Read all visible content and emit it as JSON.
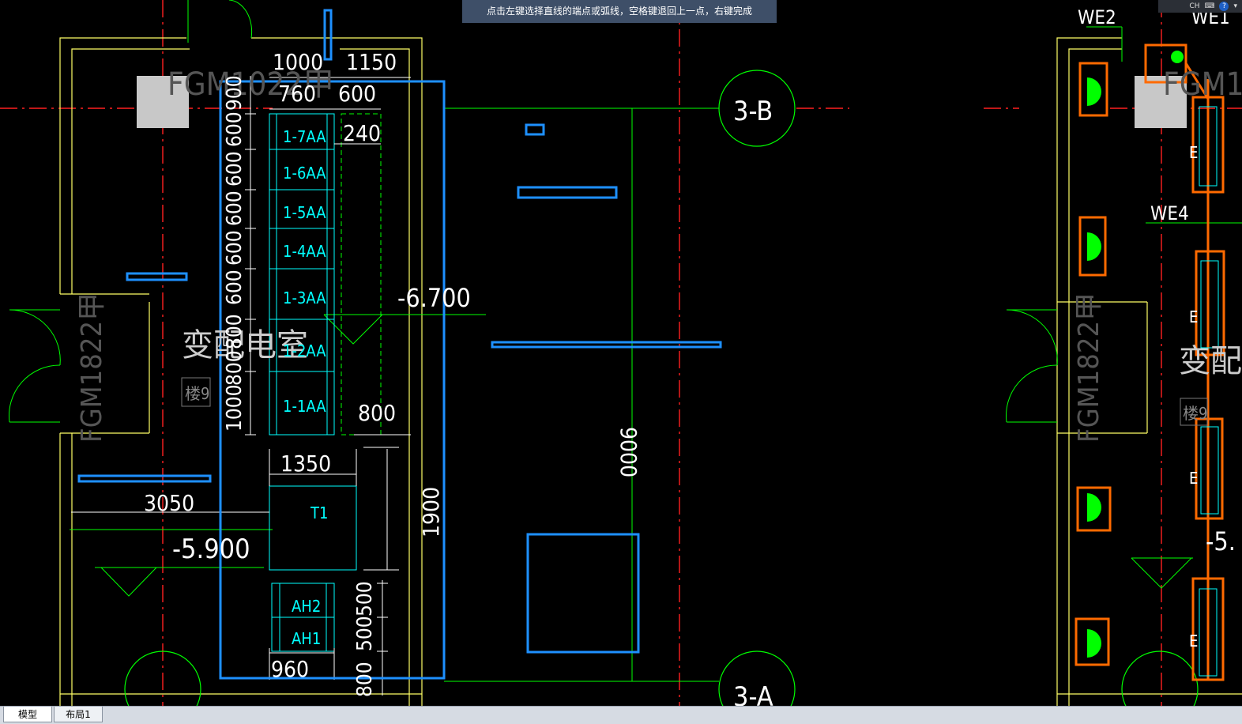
{
  "command_hint": "点击左键选择直线的端点或弧线，空格键退回上一点，右键完成",
  "system_tray": {
    "lang": "CH",
    "help": "?"
  },
  "tabs": {
    "model": "模型",
    "layout1": "布局1"
  },
  "colors": {
    "background": "#000000",
    "wall": "#ffff66",
    "axis": "#ff2020",
    "dim": "#00ff00",
    "cabinet": "#00ffff",
    "dimtext": "#ffffff",
    "selection": "#1e90ff",
    "fixture": "#ff6a00",
    "hint_bg": "#3e4f68"
  },
  "drawing": {
    "left": {
      "door_top": "FGM1022甲",
      "door_side": "FGM1822甲",
      "room": "变配电室",
      "floor_tag": "楼9",
      "elevation_low": "-5.900",
      "elevation_high": "-6.700",
      "axis_b": "3-B",
      "axis_a": "3-A",
      "dims": {
        "top1": "1000",
        "top2": "1150",
        "d760": "760",
        "d600": "600",
        "d240": "240",
        "d800": "800",
        "d1350": "1350",
        "d3050": "3050",
        "d1900": "1900",
        "d9000": "9000",
        "d960": "960",
        "vert_stack": [
          "900",
          "600",
          "600",
          "600",
          "600",
          "600",
          "800",
          "800",
          "1000"
        ],
        "vert_bottom": [
          "800",
          "500",
          "500"
        ]
      },
      "cabinets": [
        "1-7AA",
        "1-6AA",
        "1-5AA",
        "1-4AA",
        "1-3AA",
        "1-2AA",
        "1-1AA"
      ],
      "transformer": "T1",
      "lower_cabinets": [
        "AH2",
        "AH1"
      ]
    },
    "right": {
      "we2": "WE2",
      "we1": "WE1",
      "we4": "WE4",
      "door_top": "FGM1",
      "door_side": "FGM1822甲",
      "room": "变配电",
      "floor_tag": "楼9",
      "elevation": "-5.",
      "fixture_letter": "E"
    }
  }
}
